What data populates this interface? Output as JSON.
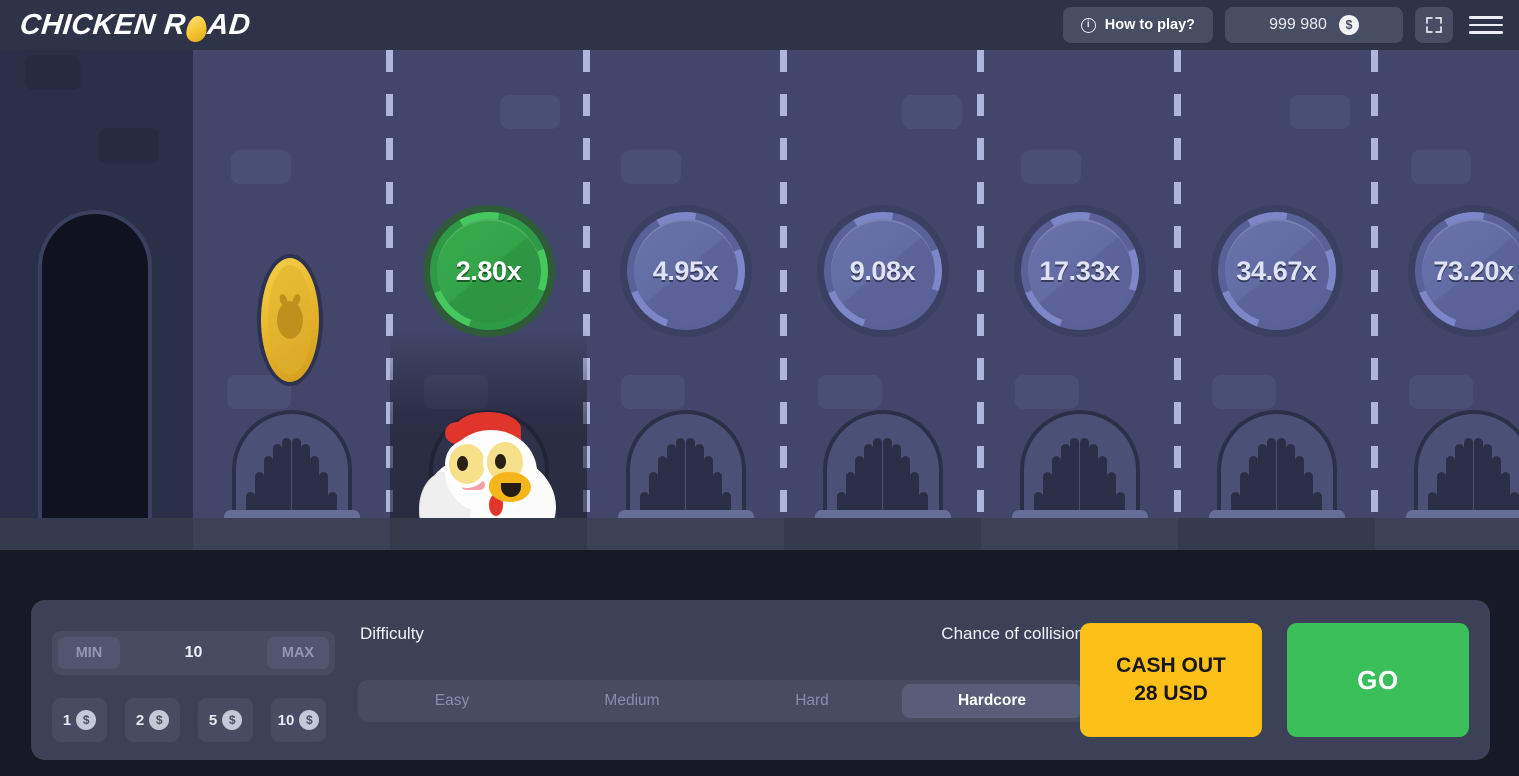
{
  "header": {
    "logo_text_1": "CHICKEN R",
    "logo_text_2": "AD",
    "logo_egg_icon": "egg-icon",
    "how_to_play_label": "How to play?",
    "info_icon": "info-icon",
    "balance": "999 980",
    "currency_icon": "dollar-coin-icon",
    "fullscreen_icon": "fullscreen-expand-icon",
    "menu_icon": "hamburger-menu-icon"
  },
  "game": {
    "character_icon": "chicken-character",
    "bonus_coin_icon": "golden-chicken-coin",
    "multipliers": [
      {
        "value": "2.80x",
        "state": "active"
      },
      {
        "value": "4.95x",
        "state": "locked"
      },
      {
        "value": "9.08x",
        "state": "locked"
      },
      {
        "value": "17.33x",
        "state": "locked"
      },
      {
        "value": "34.67x",
        "state": "locked"
      },
      {
        "value": "73.20x",
        "state": "locked"
      }
    ]
  },
  "panel": {
    "bet": {
      "min_label": "MIN",
      "max_label": "MAX",
      "value": "10",
      "chips": [
        {
          "amount": "1",
          "icon": "dollar-coin-icon"
        },
        {
          "amount": "2",
          "icon": "dollar-coin-icon"
        },
        {
          "amount": "5",
          "icon": "dollar-coin-icon"
        },
        {
          "amount": "10",
          "icon": "dollar-coin-icon"
        }
      ]
    },
    "difficulty": {
      "title": "Difficulty",
      "collision_label": "Chance of collision",
      "options": [
        {
          "label": "Easy",
          "selected": false
        },
        {
          "label": "Medium",
          "selected": false
        },
        {
          "label": "Hard",
          "selected": false
        },
        {
          "label": "Hardcore",
          "selected": true
        }
      ]
    },
    "cash_out": {
      "line1": "CASH OUT",
      "line2": "28 USD"
    },
    "go_label": "GO"
  },
  "colors": {
    "header_bg": "#2f3348",
    "road_bg": "#41466a",
    "start_zone_bg": "#2b3049",
    "panel_bg": "#3d4158",
    "accent_green": "#3bbf5b",
    "accent_yellow": "#fdc018",
    "coin_gold": "#e8b52c",
    "page_bg": "#171a26"
  }
}
